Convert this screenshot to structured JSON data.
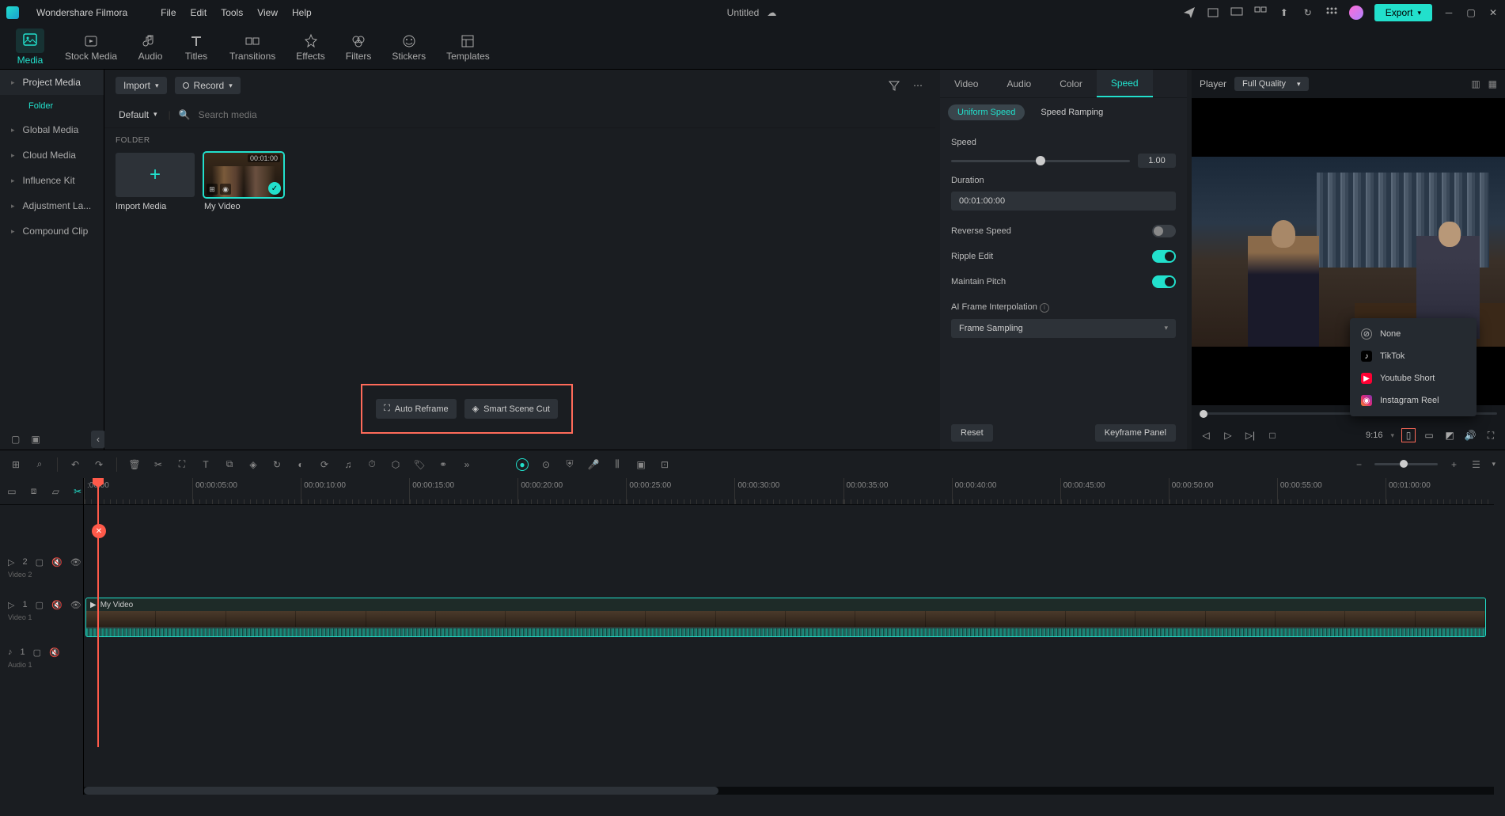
{
  "app": {
    "name": "Wondershare Filmora",
    "title": "Untitled"
  },
  "menubar": [
    "File",
    "Edit",
    "Tools",
    "View",
    "Help"
  ],
  "titlebar_actions": {
    "export": "Export"
  },
  "tooltabs": [
    {
      "id": "media",
      "label": "Media"
    },
    {
      "id": "stock",
      "label": "Stock Media"
    },
    {
      "id": "audio",
      "label": "Audio"
    },
    {
      "id": "titles",
      "label": "Titles"
    },
    {
      "id": "transitions",
      "label": "Transitions"
    },
    {
      "id": "effects",
      "label": "Effects"
    },
    {
      "id": "filters",
      "label": "Filters"
    },
    {
      "id": "stickers",
      "label": "Stickers"
    },
    {
      "id": "templates",
      "label": "Templates"
    }
  ],
  "sidebar": {
    "items": [
      {
        "label": "Project Media",
        "active": true
      },
      {
        "label": "Global Media"
      },
      {
        "label": "Cloud Media"
      },
      {
        "label": "Influence Kit"
      },
      {
        "label": "Adjustment La..."
      },
      {
        "label": "Compound Clip"
      }
    ],
    "sub": "Folder"
  },
  "media": {
    "import_btn": "Import",
    "record_btn": "Record",
    "sort": "Default",
    "search_placeholder": "Search media",
    "folder_header": "FOLDER",
    "cards": [
      {
        "label": "Import Media",
        "type": "import"
      },
      {
        "label": "My Video",
        "type": "video",
        "duration": "00:01:00",
        "selected": true
      }
    ],
    "auto_reframe": "Auto Reframe",
    "smart_cut": "Smart Scene Cut"
  },
  "props": {
    "tabs": [
      "Video",
      "Audio",
      "Color",
      "Speed"
    ],
    "active_tab": "Speed",
    "subtabs": [
      "Uniform Speed",
      "Speed Ramping"
    ],
    "active_subtab": "Uniform Speed",
    "speed_label": "Speed",
    "speed_value": "1.00",
    "duration_label": "Duration",
    "duration_value": "00:01:00:00",
    "reverse_label": "Reverse Speed",
    "reverse_on": false,
    "ripple_label": "Ripple Edit",
    "ripple_on": true,
    "pitch_label": "Maintain Pitch",
    "pitch_on": true,
    "interp_label": "AI Frame Interpolation",
    "interp_value": "Frame Sampling",
    "reset": "Reset",
    "keyframe": "Keyframe Panel"
  },
  "player": {
    "title": "Player",
    "quality": "Full Quality",
    "aspect": "9:16",
    "social_menu": [
      {
        "label": "None",
        "color": "transparent"
      },
      {
        "label": "TikTok",
        "color": "#000"
      },
      {
        "label": "Youtube Short",
        "color": "#ff0033"
      },
      {
        "label": "Instagram Reel",
        "color": "#e040a0"
      }
    ]
  },
  "timeline": {
    "ruler": [
      ":00:00",
      "00:00:05:00",
      "00:00:10:00",
      "00:00:15:00",
      "00:00:20:00",
      "00:00:25:00",
      "00:00:30:00",
      "00:00:35:00",
      "00:00:40:00",
      "00:00:45:00",
      "00:00:50:00",
      "00:00:55:00",
      "00:01:00:00"
    ],
    "tracks": {
      "video2": {
        "label": "Video 2",
        "num": "2"
      },
      "video1": {
        "label": "Video 1",
        "num": "1"
      },
      "audio1": {
        "label": "Audio 1",
        "num": "1"
      }
    },
    "clip_name": "My Video"
  }
}
